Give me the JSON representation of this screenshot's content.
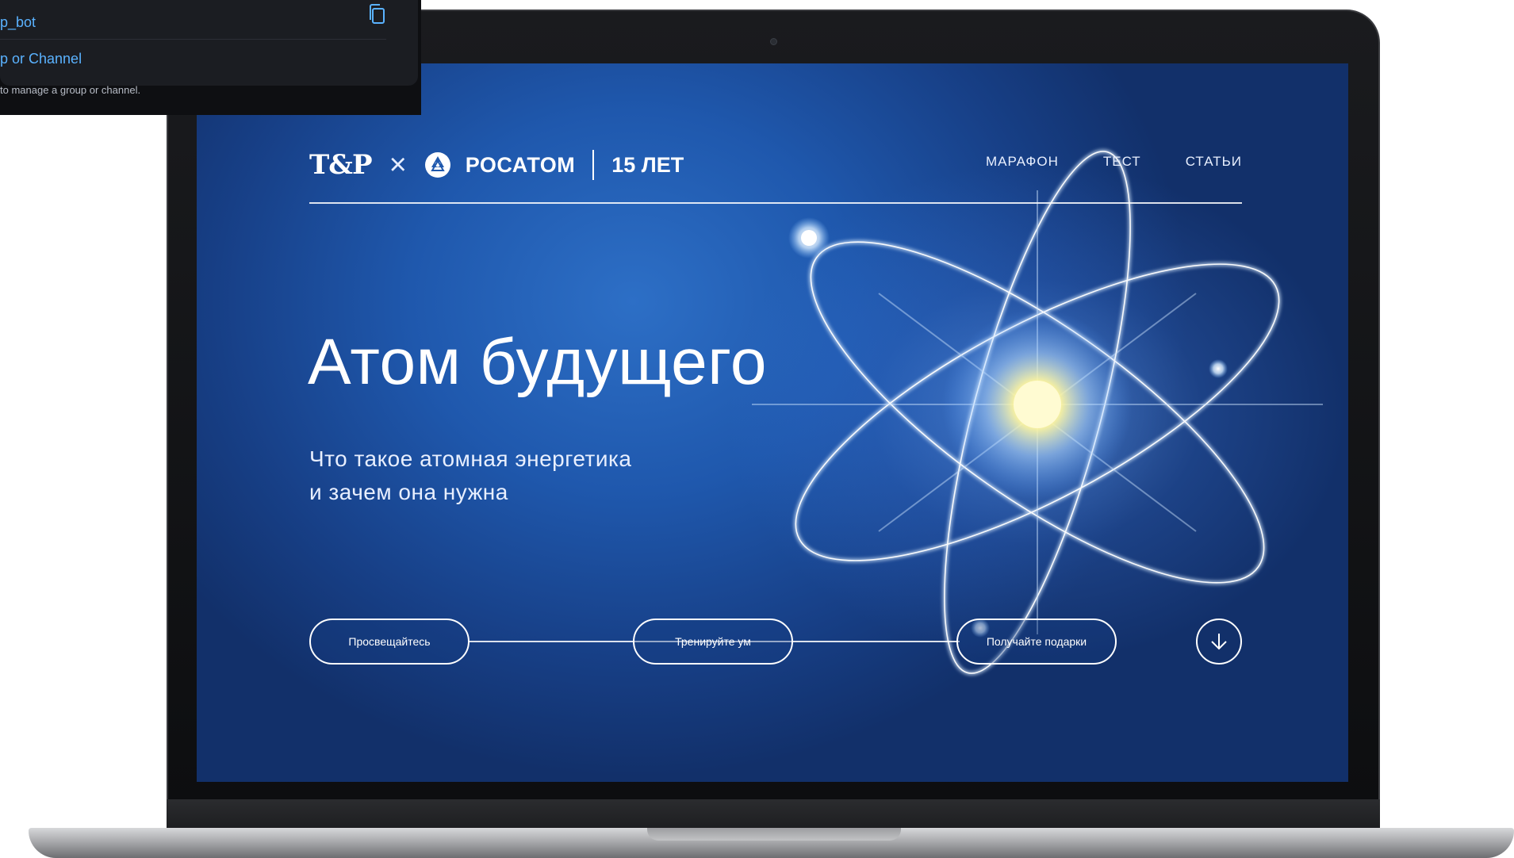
{
  "overlay": {
    "row_1": "p_bot",
    "row_2": "p or Channel",
    "hint": "to manage a group or channel."
  },
  "site": {
    "logo_tp": "T&P",
    "logo_cross": "×",
    "logo_rosatom": "РОСАТОМ",
    "logo_years": "15 ЛЕТ",
    "nav": [
      "МАРАФОН",
      "ТЕСТ",
      "СТАТЬИ"
    ],
    "hero_title": "Атом будущего",
    "hero_subtitle_line1": "Что такое атомная энергетика",
    "hero_subtitle_line2": "и зачем она нужна",
    "steps": [
      "Просвещайтесь",
      "Тренируйте ум",
      "Получайте подарки"
    ]
  },
  "colors": {
    "screen_blue": "#1f58ad",
    "link_blue": "#5ab2ff",
    "overlay_bg": "#0e0f12"
  },
  "icons": {
    "copy": "copy-icon",
    "scroll_down": "arrow-down-circle-icon",
    "rosatom": "rosatom-logo-icon"
  }
}
